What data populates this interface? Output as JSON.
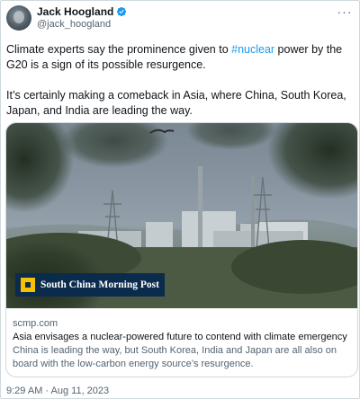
{
  "author": {
    "name": "Jack Hoogland",
    "handle": "@jack_hoogland",
    "verified_icon": "verified-badge-icon",
    "avatar_icon": "avatar"
  },
  "menu": {
    "more_icon": "more-horizontal-icon",
    "glyph": "···"
  },
  "tweet": {
    "line1_before": "Climate experts say the prominence given to ",
    "hashtag": "#nuclear",
    "line1_after": " power by the G20 is a sign of its possible resurgence.",
    "paragraph2": "It’s certainly making a comeback in Asia, where China, South Korea, Japan, and India are leading the way."
  },
  "card": {
    "logo_text": "South China Morning Post",
    "domain": "scmp.com",
    "title": "Asia envisages a nuclear-powered future to contend with climate emergency",
    "description": "China is leading the way, but South Korea, India and Japan are all also on board with the low-carbon energy source’s resurgence."
  },
  "timestamp": "9:29 AM · Aug 11, 2023",
  "colors": {
    "accent": "#1d9bf0",
    "muted": "#536471",
    "scmp_navy": "#0b2b4d",
    "scmp_yellow": "#f5c100"
  }
}
